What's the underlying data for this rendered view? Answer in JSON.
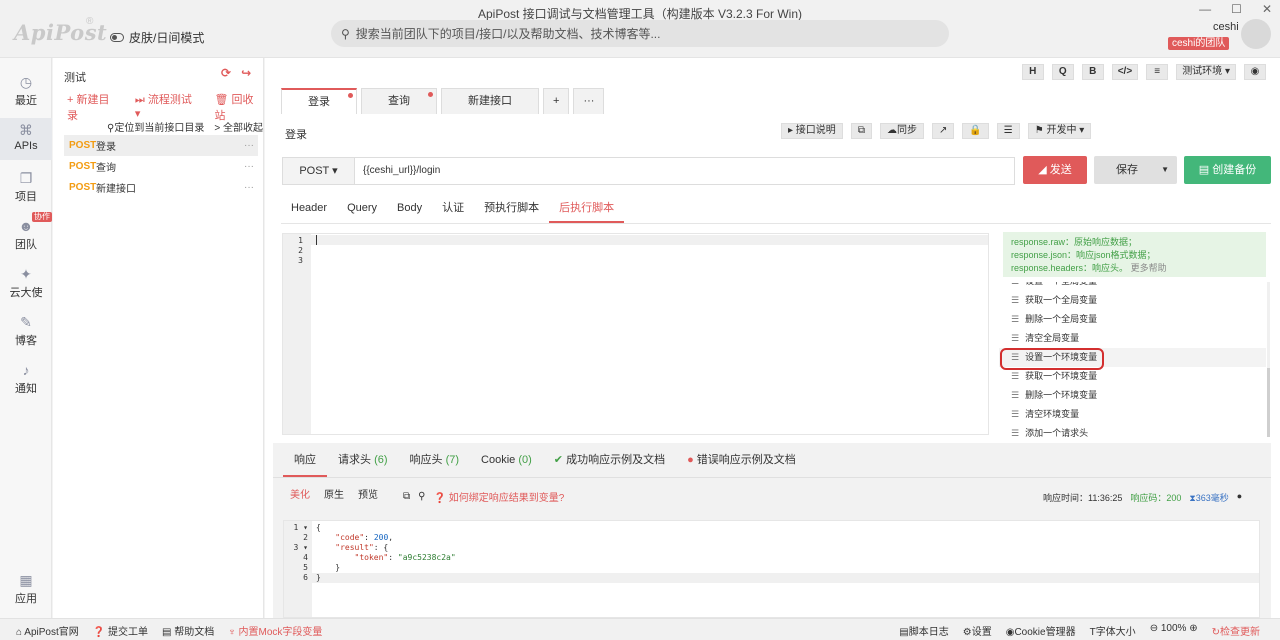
{
  "window": {
    "title": "ApiPost 接口调试与文档管理工具（构建版本 V3.2.3 For Win)",
    "logo": "ApiPost",
    "logo_mark": "®",
    "skin_toggle": "皮肤/日间模式",
    "search_placeholder": "搜索当前团队下的项目/接口/以及帮助文档、技术博客等...",
    "user_name": "ceshi",
    "team_badge": "ceshi的团队",
    "controls": [
      "—",
      "☐",
      "✕"
    ]
  },
  "leftnav": {
    "items": [
      {
        "icon": "clock-icon",
        "label": "最近",
        "glyph": "◷"
      },
      {
        "icon": "terminal-icon",
        "label": "APIs",
        "glyph": "⌘"
      },
      {
        "icon": "project-icon",
        "label": "项目",
        "glyph": "❐"
      },
      {
        "icon": "team-icon",
        "label": "团队",
        "glyph": "☻"
      },
      {
        "icon": "ambassador-icon",
        "label": "云大使",
        "glyph": "✦"
      },
      {
        "icon": "blog-icon",
        "label": "博客",
        "glyph": "✎"
      },
      {
        "icon": "bell-icon",
        "label": "通知",
        "glyph": "♪"
      },
      {
        "icon": "apps-icon",
        "label": "应用",
        "glyph": "▦"
      }
    ],
    "team_badge": "协作"
  },
  "sidebar": {
    "title": "测试",
    "new_folder": "+ 新建目录",
    "flow_test": "流程测试 ▾",
    "recycle": "回收站",
    "locate": "定位到当前接口目录",
    "collapse": "> 全部收起",
    "items": [
      {
        "method": "POST",
        "name": "登录"
      },
      {
        "method": "POST",
        "name": "查询"
      },
      {
        "method": "POST",
        "name": "新建接口"
      }
    ]
  },
  "toolbar": {
    "h": "H",
    "q": "Q",
    "b": "B",
    "code": "</>",
    "settings": "≡",
    "env": "测试环境 ▾",
    "eye": "◉"
  },
  "tabs": [
    {
      "label": "登录"
    },
    {
      "label": "查询"
    },
    {
      "label": "新建接口"
    },
    {
      "label": "+"
    },
    {
      "label": "···"
    }
  ],
  "api": {
    "title": "登录",
    "doc_btn": "▸ 接口说明",
    "copy_btn": "⧉",
    "sync_btn": "☁同步",
    "share_btn": "↗",
    "lock_btn": "🔒",
    "db_btn": "☰",
    "status_btn": "⚑ 开发中 ▾",
    "method": "POST ▾",
    "url": "{{ceshi_url}}/login",
    "send": "◢ 发送",
    "save": "保存",
    "backup": "▤ 创建备份"
  },
  "req_tabs": [
    "Header",
    "Query",
    "Body",
    "认证",
    "预执行脚本",
    "后执行脚本"
  ],
  "editor": {
    "lines": [
      "1",
      "2",
      "3"
    ]
  },
  "snippets": {
    "help_lines": [
      "response.raw：原始响应数据；",
      "response.json：响应json格式数据；",
      "response.headers：响应头。"
    ],
    "help_more": "更多帮助",
    "items": [
      "设置一个全局变量",
      "获取一个全局变量",
      "删除一个全局变量",
      "清空全局变量",
      "设置一个环境变量",
      "获取一个环境变量",
      "删除一个环境变量",
      "清空环境变量",
      "添加一个请求头"
    ]
  },
  "response": {
    "tabs": {
      "body": "响应",
      "req_headers": "请求头",
      "req_headers_count": "(6)",
      "res_headers": "响应头",
      "res_headers_count": "(7)",
      "cookie": "Cookie",
      "cookie_count": "(0)",
      "success_doc": "成功响应示例及文档",
      "error_doc": "错误响应示例及文档"
    },
    "formats": [
      "美化",
      "原生",
      "预览"
    ],
    "bind_hint": "如何绑定响应结果到变量?",
    "time_label": "响应时间：11:36:25",
    "code_label": "响应码：200",
    "duration": "363毫秒",
    "gutter": [
      "1 ▾",
      "2",
      "3 ▾",
      "4",
      "5",
      "6"
    ]
  },
  "statusbar": {
    "official": "ApiPost官网",
    "ticket": "提交工单",
    "help": "帮助文档",
    "mock": "内置Mock字段变量",
    "script_log": "脚本日志",
    "settings": "设置",
    "cookies": "Cookie管理器",
    "font": "字体大小",
    "zoom": "100%",
    "update": "检查更新"
  }
}
